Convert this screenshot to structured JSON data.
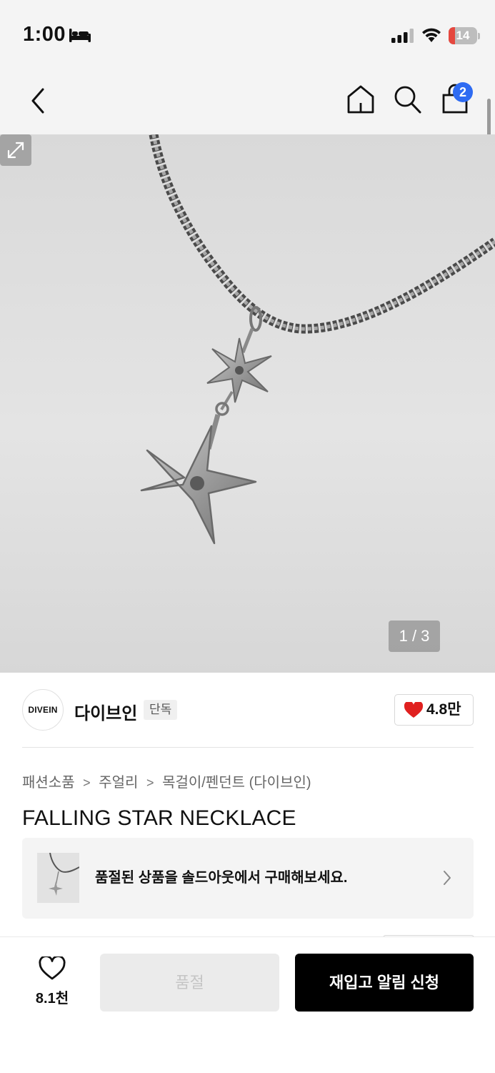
{
  "status_bar": {
    "time": "1:00",
    "battery_level": "14",
    "icons": [
      "sleep-icon",
      "signal-icon",
      "wifi-icon",
      "battery-icon"
    ]
  },
  "nav": {
    "icons": [
      "back-icon",
      "home-icon",
      "search-icon",
      "cart-icon"
    ],
    "cart_count": "2"
  },
  "gallery": {
    "page_indicator": "1 / 3",
    "expand_icon": "expand-icon"
  },
  "brand": {
    "logo_text": "DIVEIN",
    "name": "다이브인",
    "badge": "단독",
    "likes": "4.8만",
    "like_color": "#e0201f"
  },
  "breadcrumb": {
    "items": [
      "패션소품",
      "주얼리",
      "목걸이/펜던트 (다이브인)"
    ],
    "separator": ">"
  },
  "product": {
    "title": "FALLING STAR NECKLACE"
  },
  "soldout_banner": {
    "text": "품절된 상품을 솔드아웃에서 구매해보세요."
  },
  "bottom_bar": {
    "wish_count": "8.1천",
    "soldout_label": "품절",
    "restock_label": "재입고 알림 신청"
  },
  "colors": {
    "primary_button": "#000000",
    "badge_blue": "#2e6bf2",
    "disabled_button": "#ebebeb"
  }
}
